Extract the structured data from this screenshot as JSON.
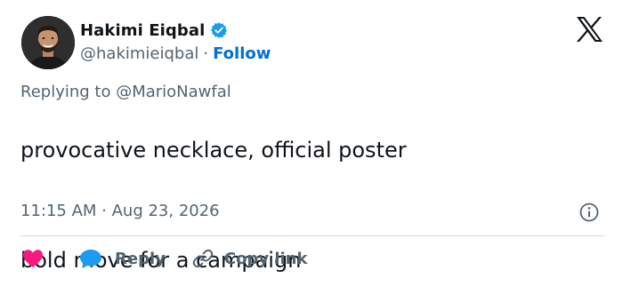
{
  "author": {
    "display_name": "Hakimi Eiqbal",
    "handle": "@hakimieiqbal",
    "separator": "·",
    "follow_label": "Follow",
    "verified": true
  },
  "reply_context": {
    "text": "Replying to @MarioNawfal"
  },
  "tweet": {
    "line1": "provocative necklace, official poster",
    "line2": "bold move for a campaign"
  },
  "meta": {
    "timestamp": "11:15 AM · Aug 23, 2026"
  },
  "actions": {
    "reply_label": "Reply",
    "copy_link_label": "Copy link"
  },
  "colors": {
    "text_primary": "#0f1419",
    "text_secondary": "#536471",
    "follow_blue": "#006fd6",
    "verified_blue": "#1d9bf0",
    "like_pink": "#f91880",
    "divider": "#cfd9de"
  },
  "icons": {
    "brand": "x-logo-icon",
    "verified": "verified-badge-icon",
    "info": "info-icon",
    "like": "heart-icon",
    "reply": "speech-bubble-icon",
    "copy": "link-icon"
  }
}
